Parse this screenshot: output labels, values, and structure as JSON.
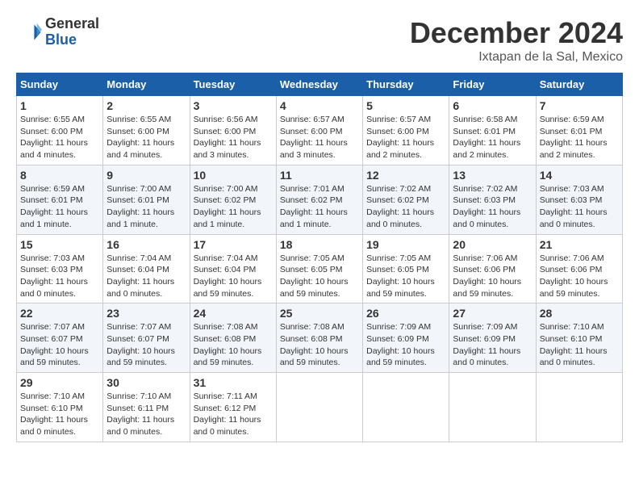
{
  "header": {
    "logo_line1": "General",
    "logo_line2": "Blue",
    "main_title": "December 2024",
    "subtitle": "Ixtapan de la Sal, Mexico"
  },
  "calendar": {
    "headers": [
      "Sunday",
      "Monday",
      "Tuesday",
      "Wednesday",
      "Thursday",
      "Friday",
      "Saturday"
    ],
    "weeks": [
      [
        {
          "day": "",
          "info": ""
        },
        {
          "day": "2",
          "info": "Sunrise: 6:55 AM\nSunset: 6:00 PM\nDaylight: 11 hours\nand 4 minutes."
        },
        {
          "day": "3",
          "info": "Sunrise: 6:56 AM\nSunset: 6:00 PM\nDaylight: 11 hours\nand 3 minutes."
        },
        {
          "day": "4",
          "info": "Sunrise: 6:57 AM\nSunset: 6:00 PM\nDaylight: 11 hours\nand 3 minutes."
        },
        {
          "day": "5",
          "info": "Sunrise: 6:57 AM\nSunset: 6:00 PM\nDaylight: 11 hours\nand 2 minutes."
        },
        {
          "day": "6",
          "info": "Sunrise: 6:58 AM\nSunset: 6:01 PM\nDaylight: 11 hours\nand 2 minutes."
        },
        {
          "day": "7",
          "info": "Sunrise: 6:59 AM\nSunset: 6:01 PM\nDaylight: 11 hours\nand 2 minutes."
        }
      ],
      [
        {
          "day": "8",
          "info": "Sunrise: 6:59 AM\nSunset: 6:01 PM\nDaylight: 11 hours\nand 1 minute."
        },
        {
          "day": "9",
          "info": "Sunrise: 7:00 AM\nSunset: 6:01 PM\nDaylight: 11 hours\nand 1 minute."
        },
        {
          "day": "10",
          "info": "Sunrise: 7:00 AM\nSunset: 6:02 PM\nDaylight: 11 hours\nand 1 minute."
        },
        {
          "day": "11",
          "info": "Sunrise: 7:01 AM\nSunset: 6:02 PM\nDaylight: 11 hours\nand 1 minute."
        },
        {
          "day": "12",
          "info": "Sunrise: 7:02 AM\nSunset: 6:02 PM\nDaylight: 11 hours\nand 0 minutes."
        },
        {
          "day": "13",
          "info": "Sunrise: 7:02 AM\nSunset: 6:03 PM\nDaylight: 11 hours\nand 0 minutes."
        },
        {
          "day": "14",
          "info": "Sunrise: 7:03 AM\nSunset: 6:03 PM\nDaylight: 11 hours\nand 0 minutes."
        }
      ],
      [
        {
          "day": "15",
          "info": "Sunrise: 7:03 AM\nSunset: 6:03 PM\nDaylight: 11 hours\nand 0 minutes."
        },
        {
          "day": "16",
          "info": "Sunrise: 7:04 AM\nSunset: 6:04 PM\nDaylight: 11 hours\nand 0 minutes."
        },
        {
          "day": "17",
          "info": "Sunrise: 7:04 AM\nSunset: 6:04 PM\nDaylight: 10 hours\nand 59 minutes."
        },
        {
          "day": "18",
          "info": "Sunrise: 7:05 AM\nSunset: 6:05 PM\nDaylight: 10 hours\nand 59 minutes."
        },
        {
          "day": "19",
          "info": "Sunrise: 7:05 AM\nSunset: 6:05 PM\nDaylight: 10 hours\nand 59 minutes."
        },
        {
          "day": "20",
          "info": "Sunrise: 7:06 AM\nSunset: 6:06 PM\nDaylight: 10 hours\nand 59 minutes."
        },
        {
          "day": "21",
          "info": "Sunrise: 7:06 AM\nSunset: 6:06 PM\nDaylight: 10 hours\nand 59 minutes."
        }
      ],
      [
        {
          "day": "22",
          "info": "Sunrise: 7:07 AM\nSunset: 6:07 PM\nDaylight: 10 hours\nand 59 minutes."
        },
        {
          "day": "23",
          "info": "Sunrise: 7:07 AM\nSunset: 6:07 PM\nDaylight: 10 hours\nand 59 minutes."
        },
        {
          "day": "24",
          "info": "Sunrise: 7:08 AM\nSunset: 6:08 PM\nDaylight: 10 hours\nand 59 minutes."
        },
        {
          "day": "25",
          "info": "Sunrise: 7:08 AM\nSunset: 6:08 PM\nDaylight: 10 hours\nand 59 minutes."
        },
        {
          "day": "26",
          "info": "Sunrise: 7:09 AM\nSunset: 6:09 PM\nDaylight: 10 hours\nand 59 minutes."
        },
        {
          "day": "27",
          "info": "Sunrise: 7:09 AM\nSunset: 6:09 PM\nDaylight: 11 hours\nand 0 minutes."
        },
        {
          "day": "28",
          "info": "Sunrise: 7:10 AM\nSunset: 6:10 PM\nDaylight: 11 hours\nand 0 minutes."
        }
      ],
      [
        {
          "day": "29",
          "info": "Sunrise: 7:10 AM\nSunset: 6:10 PM\nDaylight: 11 hours\nand 0 minutes."
        },
        {
          "day": "30",
          "info": "Sunrise: 7:10 AM\nSunset: 6:11 PM\nDaylight: 11 hours\nand 0 minutes."
        },
        {
          "day": "31",
          "info": "Sunrise: 7:11 AM\nSunset: 6:12 PM\nDaylight: 11 hours\nand 0 minutes."
        },
        {
          "day": "",
          "info": ""
        },
        {
          "day": "",
          "info": ""
        },
        {
          "day": "",
          "info": ""
        },
        {
          "day": "",
          "info": ""
        }
      ]
    ],
    "week1_day1": {
      "day": "1",
      "info": "Sunrise: 6:55 AM\nSunset: 6:00 PM\nDaylight: 11 hours\nand 4 minutes."
    }
  }
}
